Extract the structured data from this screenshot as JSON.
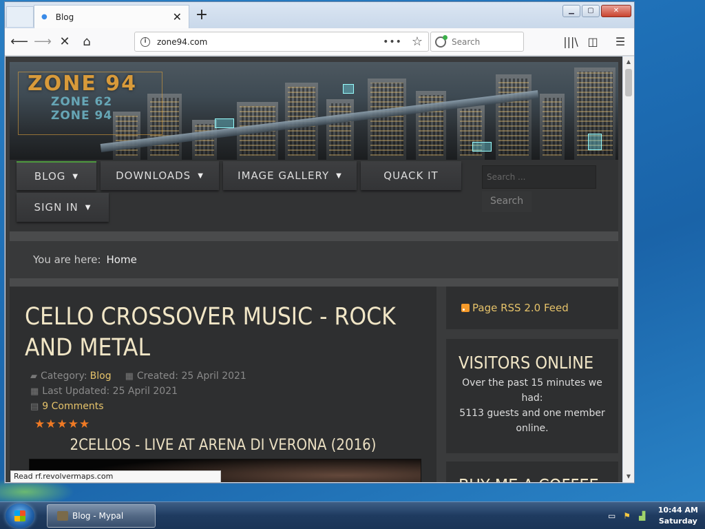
{
  "browser": {
    "tab_title": "Blog",
    "new_tab": "+",
    "url": "zone94.com",
    "search_placeholder": "Search",
    "status": "Read rf.revolvermaps.com"
  },
  "site": {
    "logo_main": "ZONE 94",
    "logo_sub_1": "ZONE 62",
    "logo_sub_2": "ZONE 94",
    "menu": [
      {
        "label": "BLOG",
        "caret": true
      },
      {
        "label": "DOWNLOADS",
        "caret": true
      },
      {
        "label": "IMAGE GALLERY",
        "caret": true
      },
      {
        "label": "QUACK IT",
        "caret": false
      },
      {
        "label": "SIGN IN",
        "caret": true
      }
    ],
    "search_placeholder": "Search ...",
    "search_button": "Search",
    "breadcrumb_prefix": "You are here:",
    "breadcrumb_home": "Home"
  },
  "article": {
    "title": "CELLO CROSSOVER MUSIC - ROCK AND METAL",
    "category_label": "Category:",
    "category": "Blog",
    "created": "Created: 25 April 2021",
    "updated": "Last Updated: 25 April 2021",
    "comments": "9 Comments",
    "stars": "★★★★★",
    "subtitle": "2CELLOS - LIVE AT ARENA DI VERONA (2016)"
  },
  "sidebar": {
    "rss": "Page RSS 2.0 Feed",
    "visitors_title": "VISITORS ONLINE",
    "visitors_text_1": "Over the past 15 minutes we had:",
    "visitors_text_2": "5113 guests and one member online.",
    "coffee_title": "BUY ME A COFFEE"
  },
  "taskbar": {
    "task_label": "Blog - Mypal",
    "time": "10:44 AM",
    "day": "Saturday"
  },
  "colors": {
    "accent_gold": "#e6c36a",
    "title_cream": "#f1e6c6",
    "star_orange": "#f07a24",
    "menu_active": "#4f9a3f"
  }
}
